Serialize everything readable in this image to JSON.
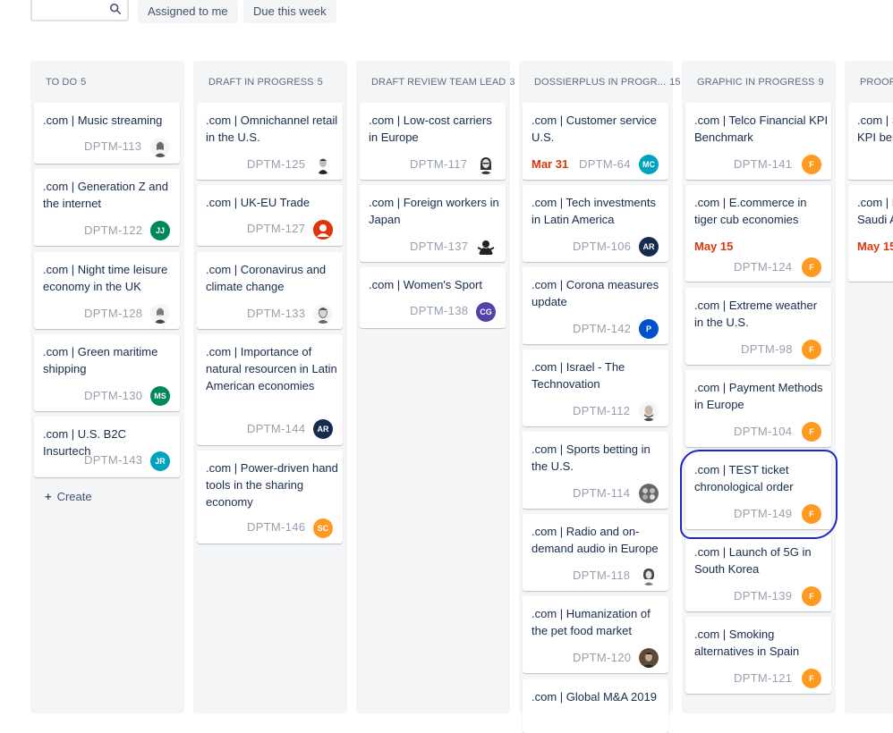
{
  "filters": {
    "search_placeholder": "",
    "assigned_to_me": "Assigned to me",
    "due_this_week": "Due this week"
  },
  "columns": [
    {
      "title": "TO DO",
      "count": "5",
      "create_label": "Create",
      "cards": [
        {
          "title": ".com | Music streaming",
          "key": "DPTM-113",
          "avatar": "photo"
        },
        {
          "title": ".com | Generation Z and the internet",
          "key": "DPTM-122",
          "avatar": "JJ",
          "avatar_color": "#00875a"
        },
        {
          "title": ".com | Night time leisure economy in the UK",
          "key": "DPTM-128",
          "avatar": "photo"
        },
        {
          "title": ".com | Green maritime shipping",
          "key": "DPTM-130",
          "avatar": "MS",
          "avatar_color": "#00875a"
        },
        {
          "title": ".com | U.S. B2C Insurtech",
          "key": "DPTM-143",
          "avatar": "JR",
          "avatar_color": "#00a3bf"
        }
      ]
    },
    {
      "title": "DRAFT IN PROGRESS",
      "count": "5",
      "cards": [
        {
          "title": ".com | Omnichannel retail in the U.S.",
          "key": "DPTM-125",
          "avatar": "photo"
        },
        {
          "title": ".com | UK-EU Trade",
          "key": "DPTM-127",
          "avatar": "person-icon",
          "avatar_color": "#de350b"
        },
        {
          "title": ".com | Coronavirus and climate change",
          "key": "DPTM-133",
          "avatar": "photo"
        },
        {
          "title": ".com | Importance of natural resourcen in Latin American economies",
          "key": "DPTM-144",
          "avatar": "AR",
          "avatar_color": "#172b4d"
        },
        {
          "title": ".com | Power-driven hand tools in the sharing economy",
          "key": "DPTM-146",
          "avatar": "SC",
          "avatar_color": "#ff991f"
        }
      ]
    },
    {
      "title": "DRAFT REVIEW TEAM LEAD",
      "count": "3",
      "cards": [
        {
          "title": ".com | Low-cost carriers in Europe",
          "key": "DPTM-117",
          "avatar": "photo"
        },
        {
          "title": ".com | Foreign workers in Japan",
          "key": "DPTM-137",
          "avatar": "photo"
        },
        {
          "title": ".com | Women's Sport",
          "key": "DPTM-138",
          "avatar": "CG",
          "avatar_color": "#5243aa"
        }
      ]
    },
    {
      "title": "DOSSIERPLUS IN PROGR...",
      "count": "15",
      "cards": [
        {
          "title": ".com | Customer service U.S.",
          "key": "DPTM-64",
          "date": "Mar 31",
          "avatar": "MC",
          "avatar_color": "#00a3bf"
        },
        {
          "title": ".com | Tech investments in Latin America",
          "key": "DPTM-106",
          "avatar": "AR",
          "avatar_color": "#172b4d"
        },
        {
          "title": ".com | Corona measures update",
          "key": "DPTM-142",
          "avatar": "P",
          "avatar_color": "#0052cc"
        },
        {
          "title": ".com | Israel - The Technovation",
          "key": "DPTM-112",
          "avatar": "photo"
        },
        {
          "title": ".com | Sports betting in the U.S.",
          "key": "DPTM-114",
          "avatar": "photo"
        },
        {
          "title": ".com | Radio and on-demand audio in Europe",
          "key": "DPTM-118",
          "avatar": "photo"
        },
        {
          "title": ".com | Humanization of the pet food market",
          "key": "DPTM-120",
          "avatar": "photo"
        },
        {
          "title": ".com | Global M&A 2019",
          "key": "",
          "avatar": ""
        }
      ]
    },
    {
      "title": "GRAPHIC IN PROGRESS",
      "count": "9",
      "cards": [
        {
          "title": ".com | Telco Financial KPI Benchmark",
          "key": "DPTM-141",
          "avatar": "F",
          "avatar_color": "#ff991f"
        },
        {
          "title": ".com | E.commerce in tiger cub economies",
          "key": "DPTM-124",
          "date": "May 15",
          "avatar": "F",
          "avatar_color": "#ff991f"
        },
        {
          "title": ".com | Extreme weather in the U.S.",
          "key": "DPTM-98",
          "avatar": "F",
          "avatar_color": "#ff991f"
        },
        {
          "title": ".com | Payment Methods in Europe",
          "key": "DPTM-104",
          "avatar": "F",
          "avatar_color": "#ff991f"
        },
        {
          "title": ".com | TEST ticket chronological order",
          "key": "DPTM-149",
          "avatar": "F",
          "avatar_color": "#ff991f"
        },
        {
          "title": ".com | Launch of 5G in South Korea",
          "key": "DPTM-139",
          "avatar": "F",
          "avatar_color": "#ff991f"
        },
        {
          "title": ".com | Smoking alternatives in Spain",
          "key": "DPTM-121",
          "avatar": "F",
          "avatar_color": "#ff991f"
        }
      ]
    },
    {
      "title": "PROOF",
      "count": "",
      "cards": [
        {
          "title": ".com | S",
          "title2": "KPI ben",
          "key": "",
          "avatar": ""
        },
        {
          "title": ".com | H",
          "title2": "Saudi A",
          "date": "May 15",
          "key": "",
          "avatar": ""
        }
      ]
    }
  ],
  "colors": {
    "column_bg": "#f4f5f7",
    "due_date": "#de350b",
    "highlight_ring": "#1b27c9"
  }
}
